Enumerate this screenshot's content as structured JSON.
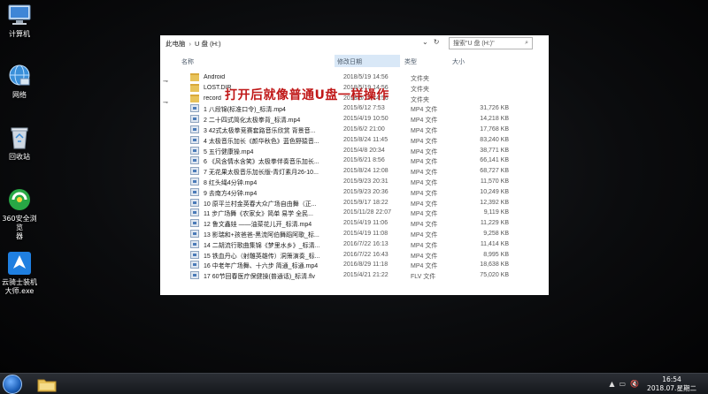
{
  "desktop": {
    "icons": [
      {
        "label": "计算机",
        "icon": "computer-icon"
      },
      {
        "label": "网络",
        "icon": "network-icon"
      },
      {
        "label": "回收站",
        "icon": "recycle-bin-icon"
      },
      {
        "label": "360安全浏览\n器",
        "icon": "browser-360-icon"
      },
      {
        "label": "云骑士装机\n大师.exe",
        "icon": "yunqishi-icon"
      }
    ]
  },
  "explorer": {
    "breadcrumb": [
      "此电脑",
      "U 盘 (H:)"
    ],
    "search_placeholder": "搜索\"U 盘 (H:)\"",
    "columns": {
      "name": "名称",
      "date": "修改日期",
      "type": "类型",
      "size": "大小"
    },
    "files": [
      {
        "name": "Android",
        "date": "2018/5/19 14:56",
        "type": "文件夹",
        "size": "",
        "kind": "folder"
      },
      {
        "name": "LOST.DIR",
        "date": "2018/5/19 14:56",
        "type": "文件夹",
        "size": "",
        "kind": "folder"
      },
      {
        "name": "record",
        "date": "2018/5/19 14:56",
        "type": "文件夹",
        "size": "",
        "kind": "folder"
      },
      {
        "name": "1 八段锦(标准口令)_标清.mp4",
        "date": "2015/6/12 7:53",
        "type": "MP4 文件",
        "size": "31,726 KB",
        "kind": "mp4"
      },
      {
        "name": "2 二十四式简化太极拳背_标清.mp4",
        "date": "2015/4/19 10:50",
        "type": "MP4 文件",
        "size": "14,218 KB",
        "kind": "mp4"
      },
      {
        "name": "3 42式太极拳竞赛套路音乐欣赏 背景音...",
        "date": "2015/6/2 21:00",
        "type": "MP4 文件",
        "size": "17,768 KB",
        "kind": "mp4"
      },
      {
        "name": "4 太极音乐加长《颜华秋色》蓝色野猿音...",
        "date": "2015/8/24 11:45",
        "type": "MP4 文件",
        "size": "83,240 KB",
        "kind": "mp4"
      },
      {
        "name": "5 五行健康操.mp4",
        "date": "2015/4/8 20:34",
        "type": "MP4 文件",
        "size": "38,771 KB",
        "kind": "mp4"
      },
      {
        "name": "6 《风含情水含笑》太极拳伴奏音乐加长...",
        "date": "2015/6/21 8:56",
        "type": "MP4 文件",
        "size": "66,141 KB",
        "kind": "mp4"
      },
      {
        "name": "7 无花果太极音乐加长版-青灯素月26-10...",
        "date": "2015/8/24 12:08",
        "type": "MP4 文件",
        "size": "68,727 KB",
        "kind": "mp4"
      },
      {
        "name": "8 红头绳4分钟.mp4",
        "date": "2015/9/23 20:31",
        "type": "MP4 文件",
        "size": "11,570 KB",
        "kind": "mp4"
      },
      {
        "name": "9 去南方4分钟.mp4",
        "date": "2015/9/23 20:36",
        "type": "MP4 文件",
        "size": "10,249 KB",
        "kind": "mp4"
      },
      {
        "name": "10 原平兰村金英春大众广场自由舞（正...",
        "date": "2015/9/17 18:22",
        "type": "MP4 文件",
        "size": "12,392 KB",
        "kind": "mp4"
      },
      {
        "name": "11 步广场舞《农家女》简单 易学 全民...",
        "date": "2015/11/28 22:07",
        "type": "MP4 文件",
        "size": "9,119 KB",
        "kind": "mp4"
      },
      {
        "name": "12 鲁文鑫娃 ——油菜花儿开_标清.mp4",
        "date": "2015/4/19 11:06",
        "type": "MP4 文件",
        "size": "11,229 KB",
        "kind": "mp4"
      },
      {
        "name": "13 影瑞和+孩爸爸-黑流阿伯舞蹈阿歌_标...",
        "date": "2015/4/19 11:08",
        "type": "MP4 文件",
        "size": "9,258 KB",
        "kind": "mp4"
      },
      {
        "name": "14 二胡流行歌曲集锦《梦里水乡》_标清...",
        "date": "2016/7/22 16:13",
        "type": "MP4 文件",
        "size": "11,414 KB",
        "kind": "mp4"
      },
      {
        "name": "15 铁血丹心（射雕英雄传）洞箫演奏_标...",
        "date": "2016/7/22 16:43",
        "type": "MP4 文件",
        "size": "8,995 KB",
        "kind": "mp4"
      },
      {
        "name": "16 中老年广场舞、十六步 简通_标通.mp4",
        "date": "2016/8/29 11:18",
        "type": "MP4 文件",
        "size": "18,638 KB",
        "kind": "mp4"
      },
      {
        "name": "17 60节回春医疗保健操(普通话)_标清.flv",
        "date": "2015/4/21 21:22",
        "type": "FLV 文件",
        "size": "75,020 KB",
        "kind": "mp4"
      }
    ],
    "overlay_caption": "打开后就像普通U盘一样操作"
  },
  "taskbar": {
    "clock_time": "16:54",
    "clock_date": "2018.07.星期二"
  }
}
